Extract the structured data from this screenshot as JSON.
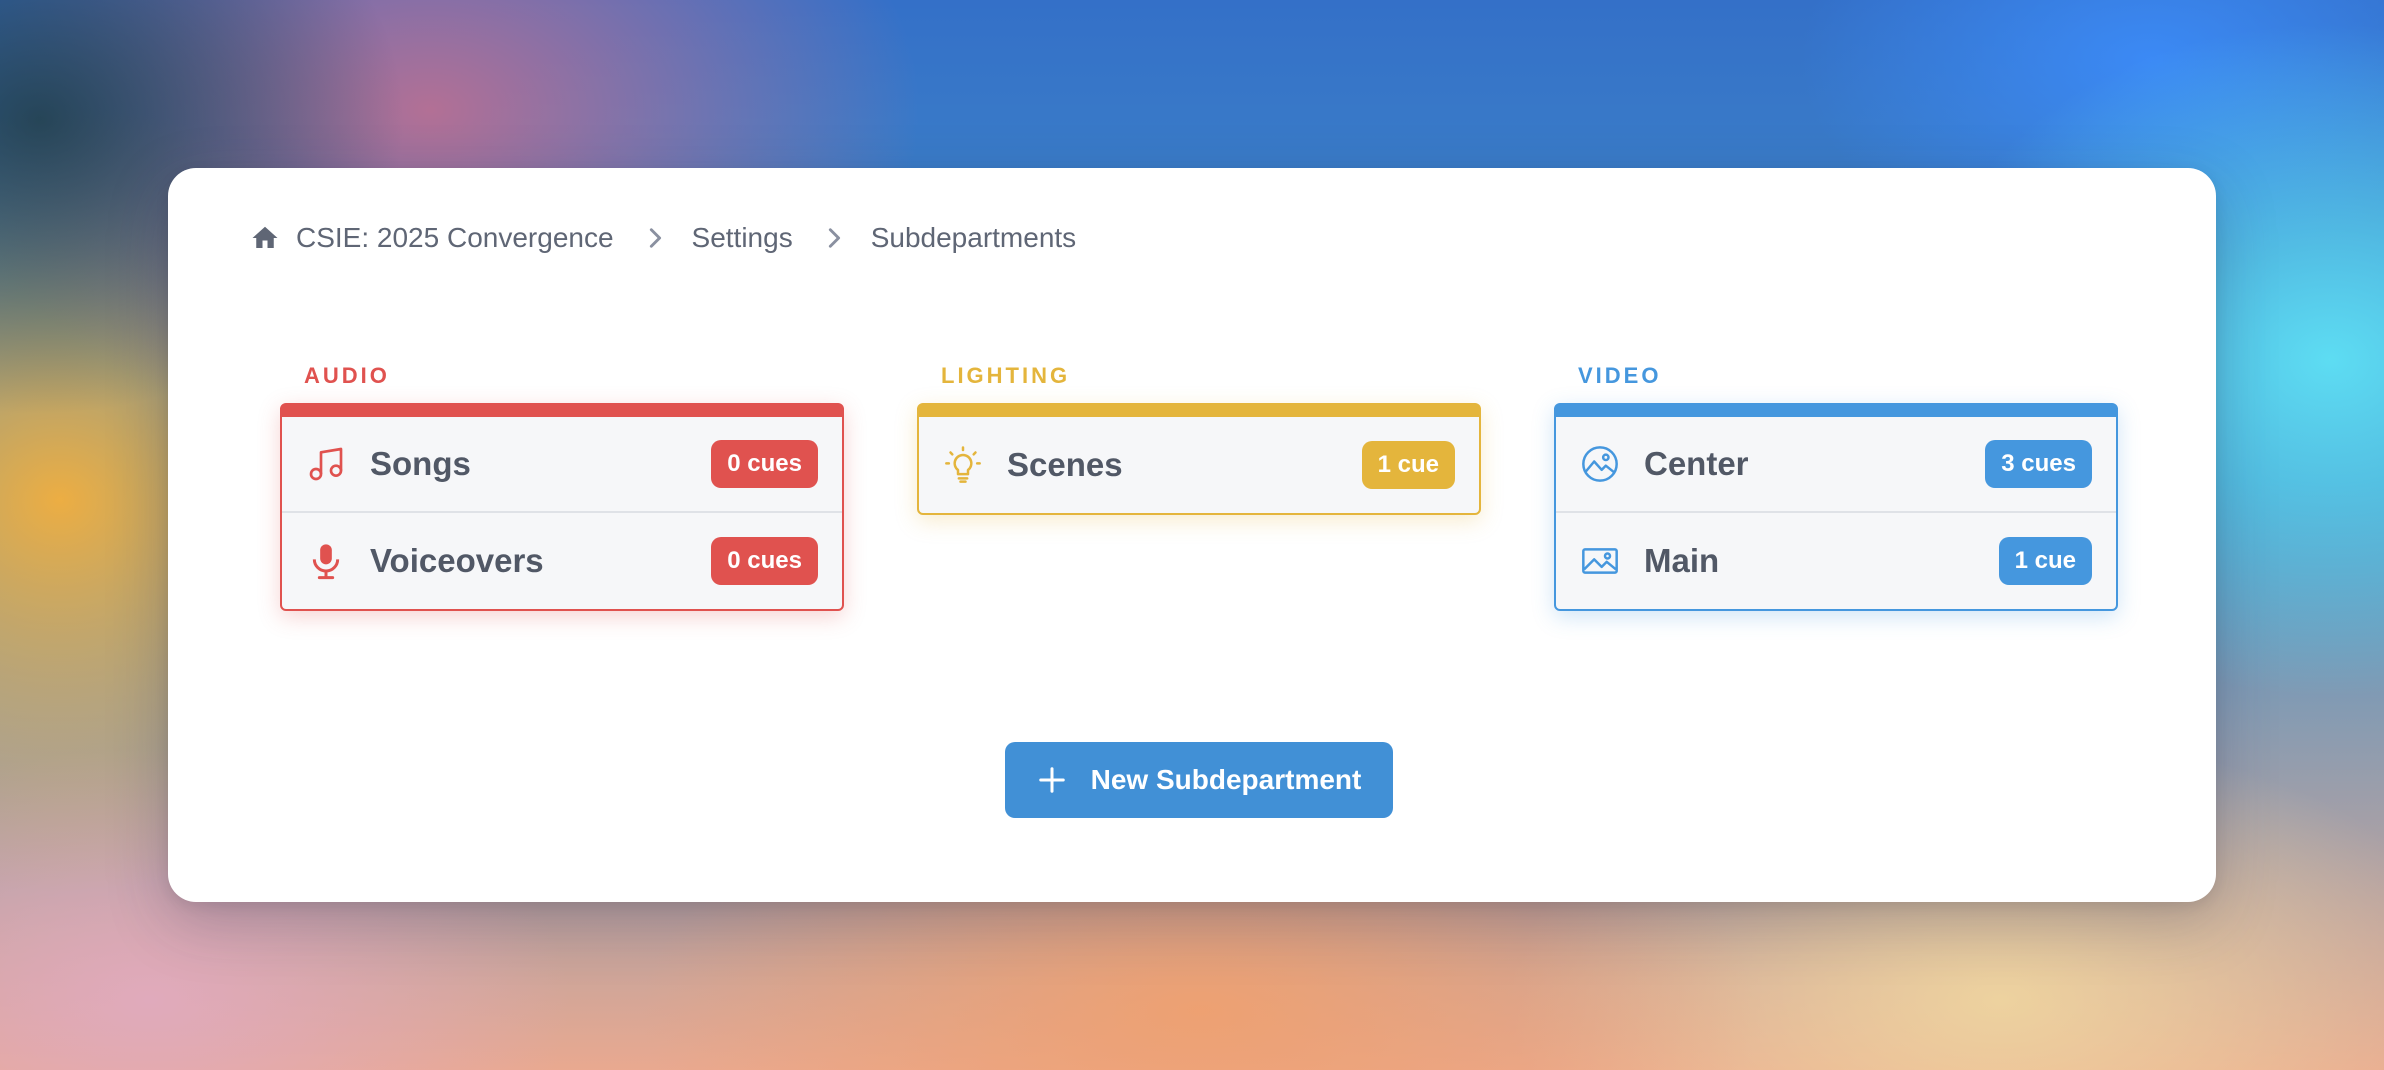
{
  "breadcrumb": {
    "icon": "home-icon",
    "items": [
      "CSIE: 2025 Convergence",
      "Settings",
      "Subdepartments"
    ]
  },
  "departments": [
    {
      "title": "AUDIO",
      "color": "#e0524f",
      "items": [
        {
          "name": "Songs",
          "icon": "music-note-icon",
          "badge": "0 cues"
        },
        {
          "name": "Voiceovers",
          "icon": "microphone-icon",
          "badge": "0 cues"
        }
      ]
    },
    {
      "title": "LIGHTING",
      "color": "#e4b53c",
      "items": [
        {
          "name": "Scenes",
          "icon": "lightbulb-icon",
          "badge": "1 cue"
        }
      ]
    },
    {
      "title": "VIDEO",
      "color": "#4597de",
      "items": [
        {
          "name": "Center",
          "icon": "image-circle-icon",
          "badge": "3 cues"
        },
        {
          "name": "Main",
          "icon": "image-icon",
          "badge": "1 cue"
        }
      ]
    }
  ],
  "actions": {
    "new_subdepartment_label": "New Subdepartment",
    "new_subdepartment_icon": "plus-icon"
  }
}
